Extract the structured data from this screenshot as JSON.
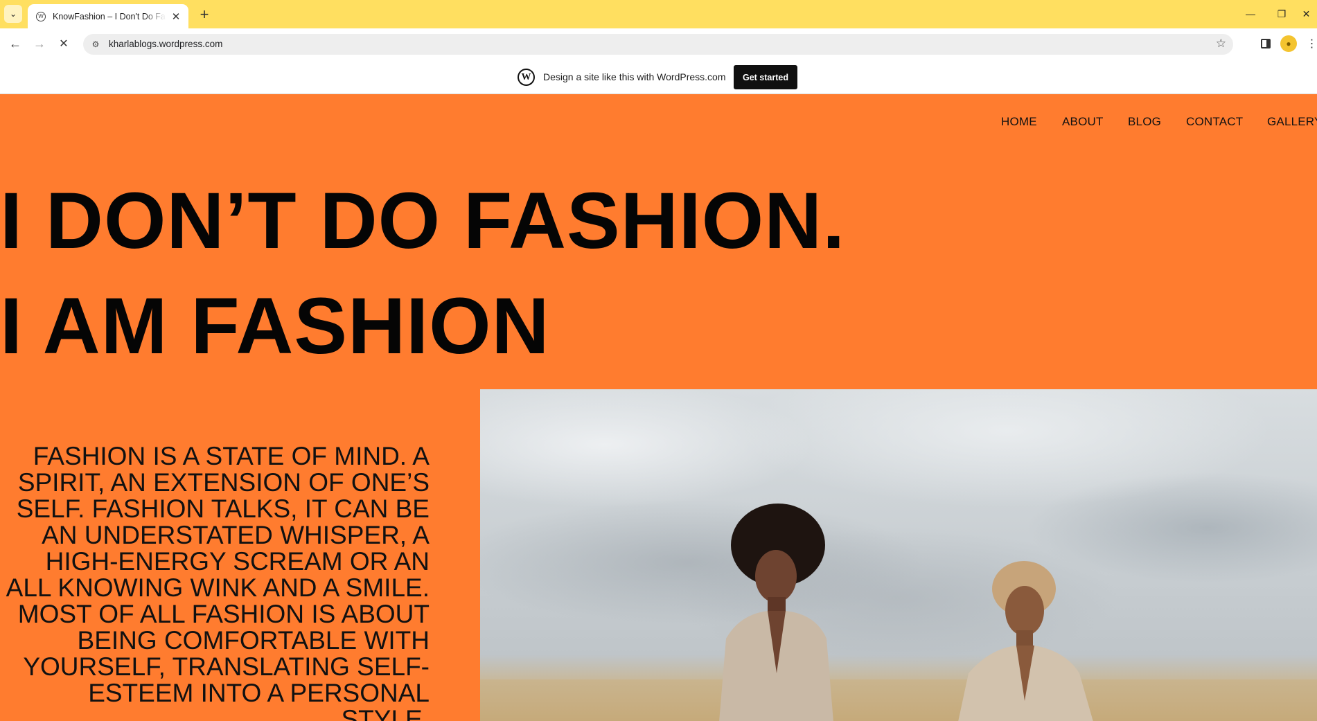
{
  "browser": {
    "tab_title": "KnowFashion – I Don't Do Fashion. I Am Fashion",
    "url": "kharlablogs.wordpress.com",
    "icons": {
      "tab_list": "chevron-down-icon",
      "new_tab": "plus-icon",
      "back": "back-arrow-icon",
      "forward": "forward-arrow-icon",
      "stop": "close-icon",
      "site_info": "tune-icon",
      "bookmark": "star-icon",
      "side_panel": "side-panel-icon",
      "profile": "person-icon",
      "menu": "more-vert-icon"
    }
  },
  "wp_banner": {
    "text": "Design a site like this with WordPress.com",
    "button": "Get started"
  },
  "site": {
    "nav": [
      "HOME",
      "ABOUT",
      "BLOG",
      "CONTACT",
      "GALLERY"
    ],
    "hero_line1": "I DON’T DO FASHION.",
    "hero_line2": "I AM FASHION",
    "quote": "FASHION IS A STATE OF MIND. A SPIRIT, AN EXTENSION OF ONE’S SELF. FASHION TALKS, IT CAN BE AN UNDERSTATED WHISPER, A HIGH-ENERGY SCREAM OR AN ALL KNOWING WINK AND A SMILE. MOST OF ALL FASHION IS ABOUT BEING COMFORTABLE WITH YOURSELF, TRANSLATING SELF-ESTEEM INTO A PERSONAL STYLE.",
    "colors": {
      "background": "#ff7c2f",
      "tabbar": "#ffdf60",
      "text": "#111111"
    }
  }
}
